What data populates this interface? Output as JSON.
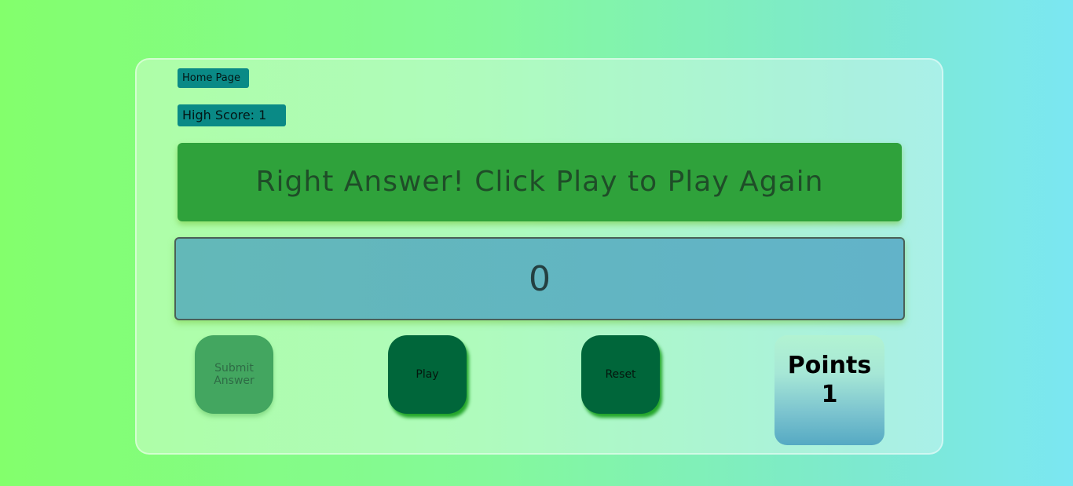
{
  "nav": {
    "home_label": "Home Page"
  },
  "high_score": {
    "text": "High Score: 1"
  },
  "message": {
    "text": "Right Answer! Click Play to Play Again"
  },
  "answer": {
    "value": "0"
  },
  "buttons": {
    "submit_line1": "Submit",
    "submit_line2": "Answer",
    "play_label": "Play",
    "reset_label": "Reset"
  },
  "points": {
    "label": "Points",
    "value": "1"
  },
  "colors": {
    "accent_teal": "#0a8a86",
    "message_green": "#2fa23b",
    "button_green": "#00663a",
    "submit_disabled": "#43a660"
  }
}
